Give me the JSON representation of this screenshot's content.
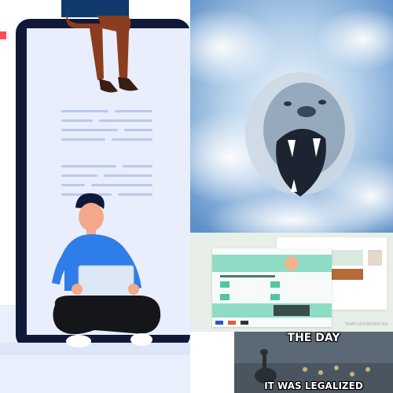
{
  "images": {
    "illustration": {
      "subject": "person sitting with laptop in front of large monitor, second person seated on top"
    },
    "lion": {
      "subject": "roaring lion emerging from clouds in blue sky"
    },
    "website_mockup": {
      "subject": "website landing page mockup",
      "watermark_text": "TEMPLATEMONSTER"
    },
    "meme": {
      "top_text": "THE DAY",
      "bottom_text": "IT WAS LEGALIZED"
    }
  },
  "colors": {
    "monitor_dark": "#101937",
    "screen_bg": "#e8eefc",
    "shirt_blue": "#2f7de8",
    "pants_dark": "#15161a",
    "accent_red": "#ff4d57",
    "sky_blue": "#8fb6df",
    "mockup_teal": "#8fdcc6"
  }
}
